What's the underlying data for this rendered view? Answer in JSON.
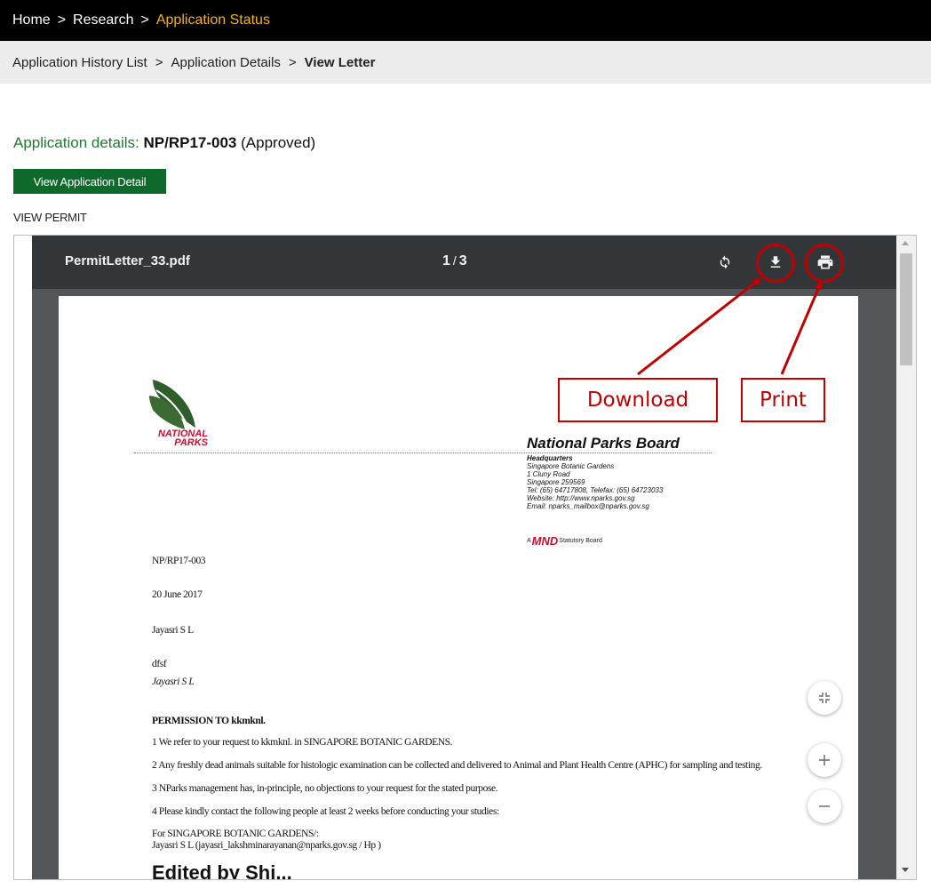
{
  "breadcrumb_top": {
    "home": "Home",
    "section": "Research",
    "current": "Application Status",
    "separator": ">"
  },
  "breadcrumb_sub": {
    "list": "Application History List",
    "details": "Application Details",
    "current": "View Letter",
    "separator": ">"
  },
  "application": {
    "prefix": "Application details:",
    "code": "NP/RP17-003",
    "status": "(Approved)"
  },
  "view_detail_button": "View Application Detail",
  "view_permit_label": "VIEW PERMIT",
  "pdf_viewer": {
    "file_name": "PermitLetter_33.pdf",
    "current_page": "1",
    "page_separator": "/",
    "total_pages": "3",
    "icons": [
      "rotate-icon",
      "download-icon",
      "print-icon",
      "fit-page-icon",
      "zoom-in-icon",
      "zoom-out-icon"
    ]
  },
  "letter": {
    "logo_text_1": "NATIONAL",
    "logo_text_2": "PARKS",
    "board_title": "National Parks Board",
    "hq_title": "Headquarters",
    "hq_lines": [
      "Singapore Botanic Gardens",
      "1 Cluny Road",
      "Singapore 259569",
      "Tel: (65) 64717808, Telefax: (65) 64723033",
      "Website: http://www.nparks.gov.sg",
      "Email: nparks_mailbox@nparks.gov.sg"
    ],
    "mnd_prefix": "A",
    "mnd_mark": "MND",
    "mnd_suffix": "Statutory Board",
    "ref": "NP/RP17-003",
    "date": "20 June 2017",
    "recipient": "Jayasri S L",
    "line_dfsf": "dfsf",
    "signature_name": "Jayasri S L",
    "permission_heading": "PERMISSION TO kkmknl.",
    "para_1": "1 We refer to your request to kkmknl. in SINGAPORE BOTANIC GARDENS.",
    "para_2": "2 Any freshly dead animals suitable for histologic examination can be collected and delivered to Animal and Plant Health Centre (APHC) for sampling and testing.",
    "para_3": "3 NParks management has, in-principle, no objections to your request for the stated purpose.",
    "para_4": "4 Please kindly contact the following people at least 2 weeks before conducting your studies:",
    "contact_1": "For SINGAPORE BOTANIC GARDENS/:",
    "contact_2": "Jayasri S L (jayasri_lakshminarayanan@nparks.gov.sg / Hp )",
    "partial_heading": "Edited by Shi..."
  },
  "annotations": {
    "download_label": "Download",
    "print_label": "Print",
    "color": "#c00000"
  },
  "colors": {
    "top_bar": "#000000",
    "breadcrumb_current": "#f5b31a",
    "sub_bar": "#ececec",
    "title_green": "#1e7a2c",
    "button_green": "#0e6a2a",
    "pdf_toolbar": "#323639",
    "pdf_background": "#525659"
  }
}
